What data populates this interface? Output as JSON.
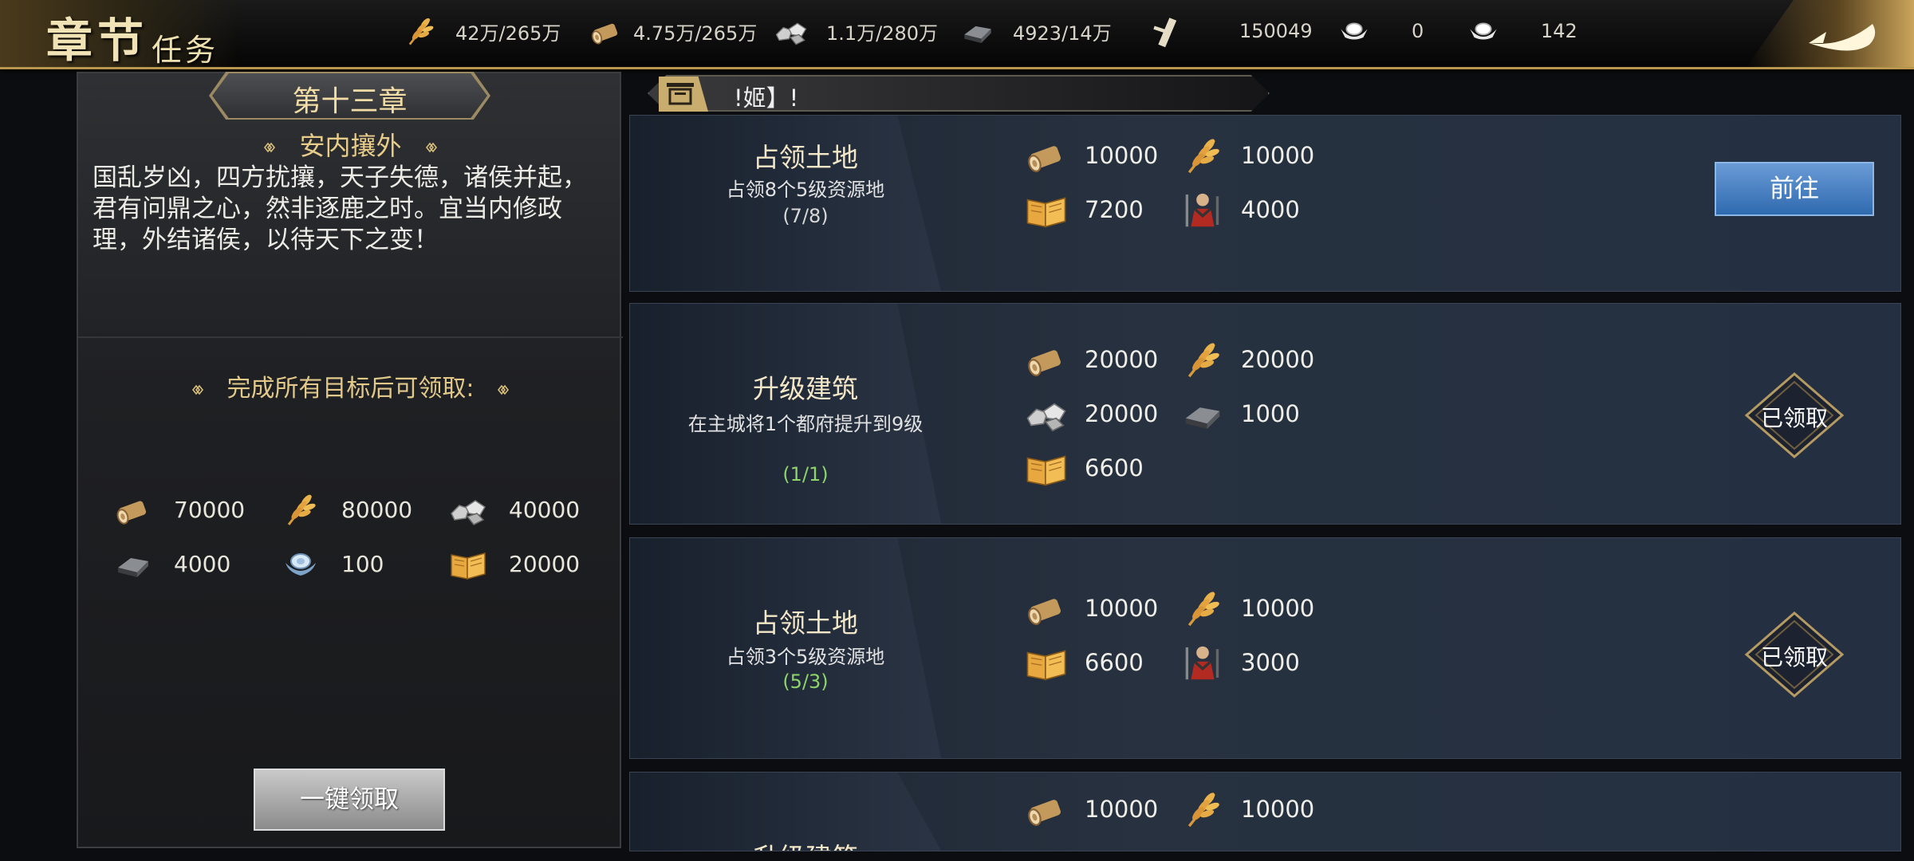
{
  "header": {
    "title_main": "章节",
    "title_sub": "任务",
    "resources": [
      {
        "icon": "grain-icon",
        "value": "42万/265万"
      },
      {
        "icon": "wood-icon",
        "value": "4.75万/265万"
      },
      {
        "icon": "stone-icon",
        "value": "1.1万/280万"
      },
      {
        "icon": "iron-icon",
        "value": "4923/14万"
      },
      {
        "icon": "decree-icon",
        "value": "150049"
      },
      {
        "icon": "gold-ingot-icon",
        "value": "0"
      },
      {
        "icon": "silver-ingot-icon",
        "value": "142"
      }
    ],
    "back_icon": "back-arrow-icon"
  },
  "chapter": {
    "title": "第十三章",
    "subtitle": "安内攘外",
    "description": "国乱岁凶，四方扰攘，天子失德，诸侯并起，君有问鼎之心，然非逐鹿之时。宜当内修政理，外结诸侯，以待天下之变！",
    "reward_title": "完成所有目标后可领取:",
    "rewards": [
      {
        "icon": "wood-icon",
        "value": "70000"
      },
      {
        "icon": "grain-icon",
        "value": "80000"
      },
      {
        "icon": "stone-icon",
        "value": "40000"
      },
      {
        "icon": "iron-icon",
        "value": "4000"
      },
      {
        "icon": "silver-ingot-icon",
        "value": "100"
      },
      {
        "icon": "book-icon",
        "value": "20000"
      }
    ],
    "claim_all_label": "一键领取"
  },
  "notice": {
    "text": "!姬】!"
  },
  "tasks": [
    {
      "name": "占领土地",
      "desc": "占领8个5级资源地",
      "progress": "(7/8)",
      "progress_color": "#d8d8d8",
      "rewards": [
        {
          "icon": "wood-icon",
          "value": "10000"
        },
        {
          "icon": "grain-icon",
          "value": "10000"
        },
        {
          "icon": "book-icon",
          "value": "7200"
        },
        {
          "icon": "troops-icon",
          "value": "4000"
        }
      ],
      "action": "前往",
      "status": "go"
    },
    {
      "name": "升级建筑",
      "desc": "在主城将1个都府提升到9级",
      "progress": "(1/1)",
      "progress_color": "#8ed46a",
      "rewards": [
        {
          "icon": "wood-icon",
          "value": "20000"
        },
        {
          "icon": "grain-icon",
          "value": "20000"
        },
        {
          "icon": "stone-icon",
          "value": "20000"
        },
        {
          "icon": "iron-icon",
          "value": "1000"
        },
        {
          "icon": "book-icon",
          "value": "6600"
        }
      ],
      "action": "已领取",
      "status": "claimed"
    },
    {
      "name": "占领土地",
      "desc": "占领3个5级资源地",
      "progress": "(5/3)",
      "progress_color": "#8ed46a",
      "rewards": [
        {
          "icon": "wood-icon",
          "value": "10000"
        },
        {
          "icon": "grain-icon",
          "value": "10000"
        },
        {
          "icon": "book-icon",
          "value": "6600"
        },
        {
          "icon": "troops-icon",
          "value": "3000"
        }
      ],
      "action": "已领取",
      "status": "claimed"
    },
    {
      "name": "升级建筑",
      "rewards": [
        {
          "icon": "wood-icon",
          "value": "10000"
        },
        {
          "icon": "grain-icon",
          "value": "10000"
        }
      ]
    }
  ]
}
